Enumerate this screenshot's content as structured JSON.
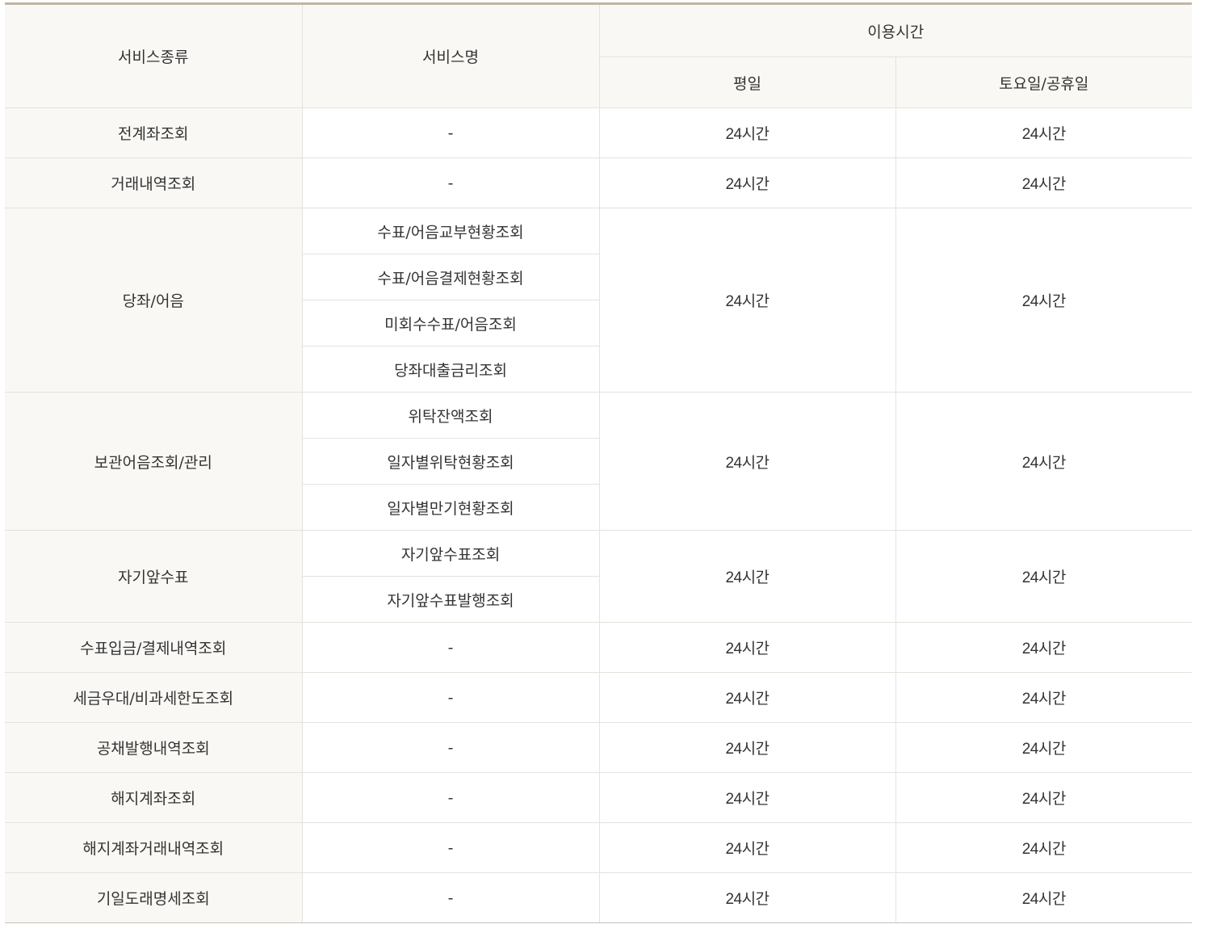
{
  "table": {
    "headers": {
      "service_type": "서비스종류",
      "service_name": "서비스명",
      "usage_time": "이용시간",
      "weekday": "평일",
      "weekend": "토요일/공휴일"
    },
    "groups": [
      {
        "category": "전계좌조회",
        "services": [
          "-"
        ],
        "weekday": "24시간",
        "weekend": "24시간"
      },
      {
        "category": "거래내역조회",
        "services": [
          "-"
        ],
        "weekday": "24시간",
        "weekend": "24시간"
      },
      {
        "category": "당좌/어음",
        "services": [
          "수표/어음교부현황조회",
          "수표/어음결제현황조회",
          "미회수수표/어음조회",
          "당좌대출금리조회"
        ],
        "weekday": "24시간",
        "weekend": "24시간"
      },
      {
        "category": "보관어음조회/관리",
        "services": [
          "위탁잔액조회",
          "일자별위탁현황조회",
          "일자별만기현황조회"
        ],
        "weekday": "24시간",
        "weekend": "24시간"
      },
      {
        "category": "자기앞수표",
        "services": [
          "자기앞수표조회",
          "자기앞수표발행조회"
        ],
        "weekday": "24시간",
        "weekend": "24시간"
      },
      {
        "category": "수표입금/결제내역조회",
        "services": [
          "-"
        ],
        "weekday": "24시간",
        "weekend": "24시간"
      },
      {
        "category": "세금우대/비과세한도조회",
        "services": [
          "-"
        ],
        "weekday": "24시간",
        "weekend": "24시간"
      },
      {
        "category": "공채발행내역조회",
        "services": [
          "-"
        ],
        "weekday": "24시간",
        "weekend": "24시간"
      },
      {
        "category": "해지계좌조회",
        "services": [
          "-"
        ],
        "weekday": "24시간",
        "weekend": "24시간"
      },
      {
        "category": "해지계좌거래내역조회",
        "services": [
          "-"
        ],
        "weekday": "24시간",
        "weekend": "24시간"
      },
      {
        "category": "기일도래명세조회",
        "services": [
          "-"
        ],
        "weekday": "24시간",
        "weekend": "24시간"
      }
    ]
  }
}
